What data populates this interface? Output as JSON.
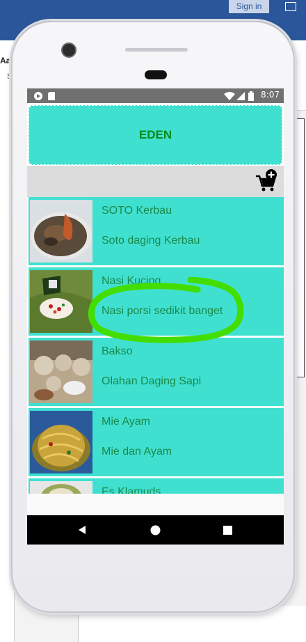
{
  "desktop": {
    "sign_in": "Sign in",
    "ribbon_text": "Aal",
    "ribbon_sub": "S"
  },
  "status_bar": {
    "time": "8:07"
  },
  "app": {
    "title": "EDEN",
    "accent_color": "#40e0d0",
    "text_color": "#1a8a4a",
    "cart_icon": "add-to-cart-icon"
  },
  "menu": [
    {
      "title": "SOTO Kerbau",
      "description": "Soto daging Kerbau",
      "image": "soto-photo"
    },
    {
      "title": "Nasi Kucing",
      "description": "Nasi porsi sedikit banget",
      "image": "nasi-kucing-photo"
    },
    {
      "title": "Bakso",
      "description": "Olahan Daging Sapi",
      "image": "bakso-photo"
    },
    {
      "title": "Mie Ayam",
      "description": "Mie dan Ayam",
      "image": "mie-ayam-photo"
    },
    {
      "title": "Es Klamuds",
      "description": "",
      "image": "es-kelapa-photo"
    }
  ],
  "annotation": {
    "color": "#44dd00",
    "shape": "circle-highlight"
  }
}
